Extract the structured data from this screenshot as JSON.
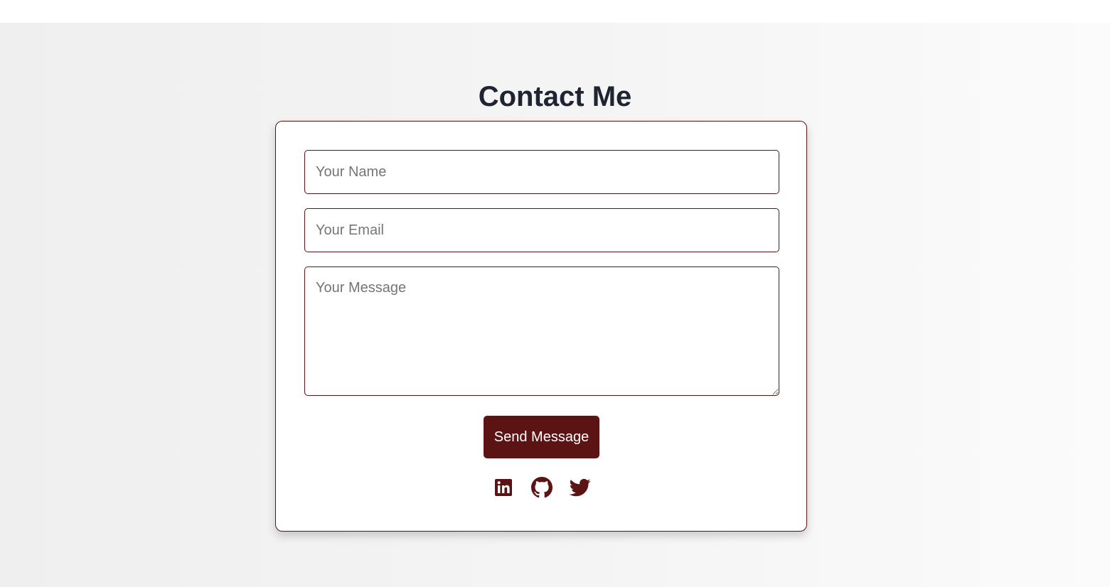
{
  "page": {
    "title": "Contact Me"
  },
  "form": {
    "name_placeholder": "Your Name",
    "name_value": "",
    "email_placeholder": "Your Email",
    "email_value": "",
    "message_placeholder": "Your Message",
    "message_value": "",
    "submit_label": "Send Message"
  },
  "socials": [
    {
      "icon": "linkedin-icon"
    },
    {
      "icon": "github-icon"
    },
    {
      "icon": "twitter-icon"
    }
  ],
  "colors": {
    "accent": "#5c1313",
    "heading": "#1e2530",
    "background": "#f2f2f2"
  }
}
